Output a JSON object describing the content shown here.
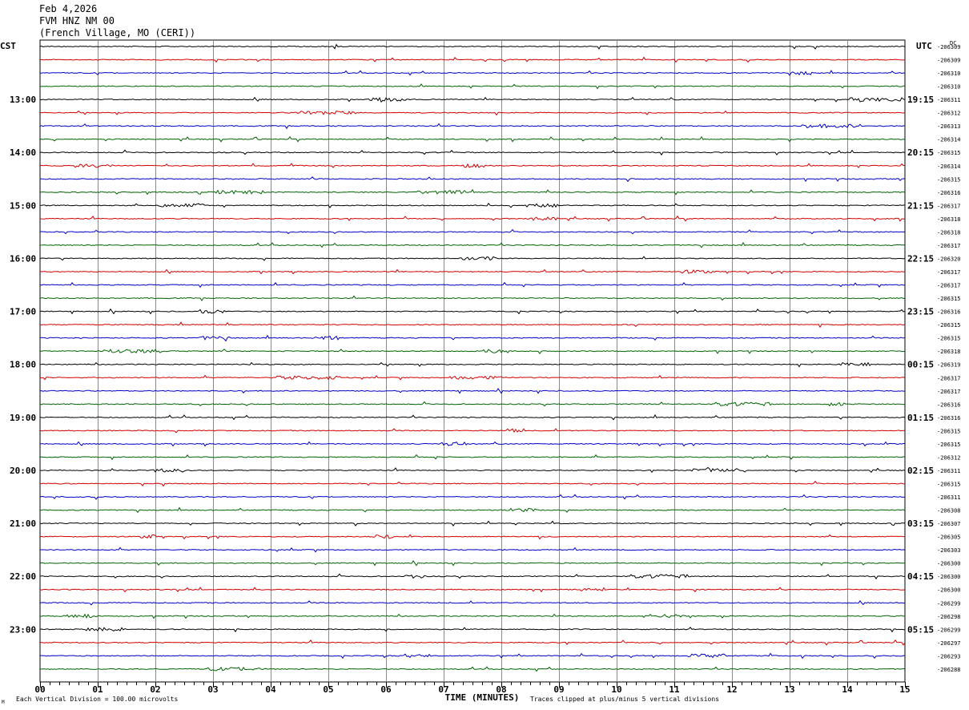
{
  "header": {
    "date": "Feb 4,2026",
    "station": "FVM HNZ NM 00",
    "location": "(French Village, MO (CERI))"
  },
  "chart_data": {
    "type": "line",
    "title": "FVM HNZ NM 00",
    "left_zone_label": "CST",
    "right_zone_label": "UTC",
    "dc_label": "DC",
    "xlabel": "TIME (MINUTES)",
    "xlim": [
      0,
      15
    ],
    "x_ticks": [
      "00",
      "01",
      "02",
      "03",
      "04",
      "05",
      "06",
      "07",
      "08",
      "09",
      "10",
      "11",
      "12",
      "13",
      "14",
      "15"
    ],
    "left_hour_labels": [
      "13:00",
      "14:00",
      "15:00",
      "16:00",
      "17:00",
      "18:00",
      "19:00",
      "20:00",
      "21:00",
      "22:00",
      "23:00"
    ],
    "right_hour_labels": [
      "19:15",
      "20:15",
      "21:15",
      "22:15",
      "23:15",
      "00:15",
      "01:15",
      "02:15",
      "03:15",
      "04:15",
      "05:15"
    ],
    "trace_colors": [
      "#000000",
      "#d40000",
      "#0000c8",
      "#006400"
    ],
    "dc_offsets": [
      "-206309",
      "-206309",
      "-206310",
      "-206310",
      "-206311",
      "-206312",
      "-206313",
      "-206314",
      "-206315",
      "-206314",
      "-206315",
      "-206316",
      "-206317",
      "-206318",
      "-206318",
      "-206317",
      "-206320",
      "-206317",
      "-206317",
      "-206315",
      "-206316",
      "-206315",
      "-206315",
      "-206318",
      "-206319",
      "-206317",
      "-206317",
      "-206316",
      "-206316",
      "-206315",
      "-206315",
      "-206312",
      "-206311",
      "-206315",
      "-206311",
      "-206308",
      "-206307",
      "-206305",
      "-206303",
      "-206300",
      "-206300",
      "-206300",
      "-206299",
      "-206298",
      "-206299",
      "-206297",
      "-206293",
      "-206288"
    ],
    "footer_left": "Each Vertical Division =  100.00 microvolts",
    "footer_right": "Traces clipped at plus/minus 5 vertical divisions",
    "corner_mark": "M"
  }
}
